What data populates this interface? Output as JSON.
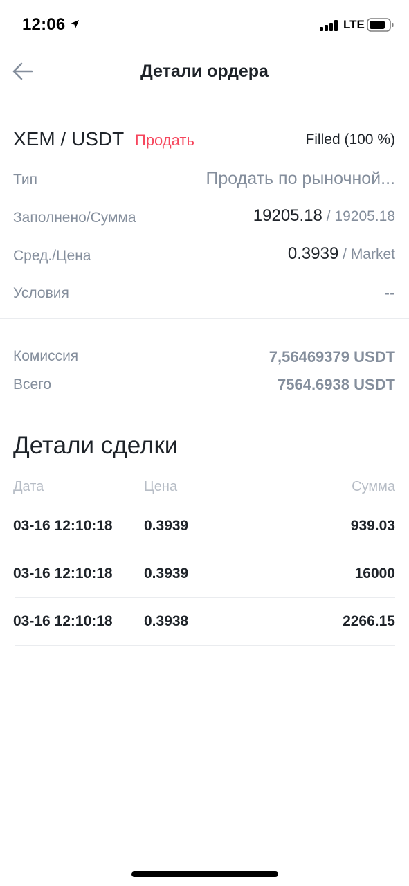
{
  "status_bar": {
    "time": "12:06",
    "network": "LTE",
    "icons": [
      "location-arrow-icon",
      "signal-bars-icon",
      "battery-icon"
    ]
  },
  "nav": {
    "title": "Детали ордера",
    "back_icon": "back-arrow-icon"
  },
  "order": {
    "pair": "XEM / USDT",
    "side": "Продать",
    "status": "Filled (100 %)",
    "side_color": "#f6465d",
    "rows": {
      "type": {
        "label": "Тип",
        "value": "Продать по рыночной..."
      },
      "filled": {
        "label": "Заполнено/Сумма",
        "filled": "19205.18",
        "separator": " / ",
        "amount": "19205.18"
      },
      "avg_price": {
        "label": "Сред./Цена",
        "avg": "0.3939",
        "separator": " / ",
        "price": "Market"
      },
      "conditions": {
        "label": "Условия",
        "value": "--"
      }
    }
  },
  "fees": {
    "commission": {
      "label": "Комиссия",
      "value": "7,56469379 USDT"
    },
    "total": {
      "label": "Всего",
      "value": "7564.6938 USDT"
    }
  },
  "trade_details": {
    "title": "Детали сделки",
    "columns": {
      "date": "Дата",
      "price": "Цена",
      "amount": "Сумма"
    },
    "rows": [
      {
        "date": "03-16 12:10:18",
        "price": "0.3939",
        "amount": "939.03"
      },
      {
        "date": "03-16 12:10:18",
        "price": "0.3939",
        "amount": "16000"
      },
      {
        "date": "03-16 12:10:18",
        "price": "0.3938",
        "amount": "2266.15"
      }
    ]
  }
}
